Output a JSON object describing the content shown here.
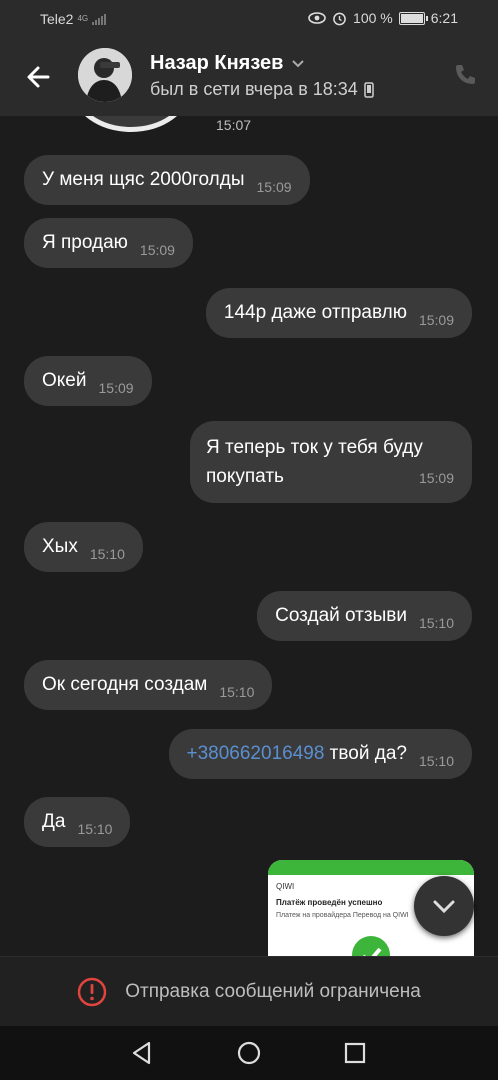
{
  "status_bar": {
    "carrier": "Tele2",
    "network": "4G",
    "battery": "100 %",
    "time": "6:21"
  },
  "header": {
    "contact_name": "Назар Князев",
    "last_seen": "был в сети вчера в 18:34"
  },
  "sticker_time": "15:07",
  "messages": [
    {
      "text": "У меня щяс 2000голды",
      "time": "15:09",
      "side": "in"
    },
    {
      "text": "Я продаю",
      "time": "15:09",
      "side": "in"
    },
    {
      "text": "144р даже отправлю",
      "time": "15:09",
      "side": "out"
    },
    {
      "text": "Окей",
      "time": "15:09",
      "side": "in"
    },
    {
      "line1": "Я теперь ток у тебя буду",
      "line2": "покупать",
      "time": "15:09",
      "side": "out"
    },
    {
      "text": "Хых",
      "time": "15:10",
      "side": "in"
    },
    {
      "text": "Создай отзыви",
      "time": "15:10",
      "side": "out"
    },
    {
      "text": "Ок сегодня создам",
      "time": "15:10",
      "side": "in"
    },
    {
      "link": "+380662016498",
      "text": " твой да?",
      "time": "15:10",
      "side": "out"
    },
    {
      "text": "Да",
      "time": "15:10",
      "side": "in"
    }
  ],
  "preview": {
    "logo": "QIWI",
    "title": "Платёж проведён успешно",
    "subtitle": "Платеж на провайдера Перевод на QIWI"
  },
  "restriction_text": "Отправка сообщений ограничена",
  "colors": {
    "accent_link": "#5b8fd0",
    "bubble": "#3a3a3a",
    "background": "#1c1c1c",
    "warning": "#e0443e"
  }
}
